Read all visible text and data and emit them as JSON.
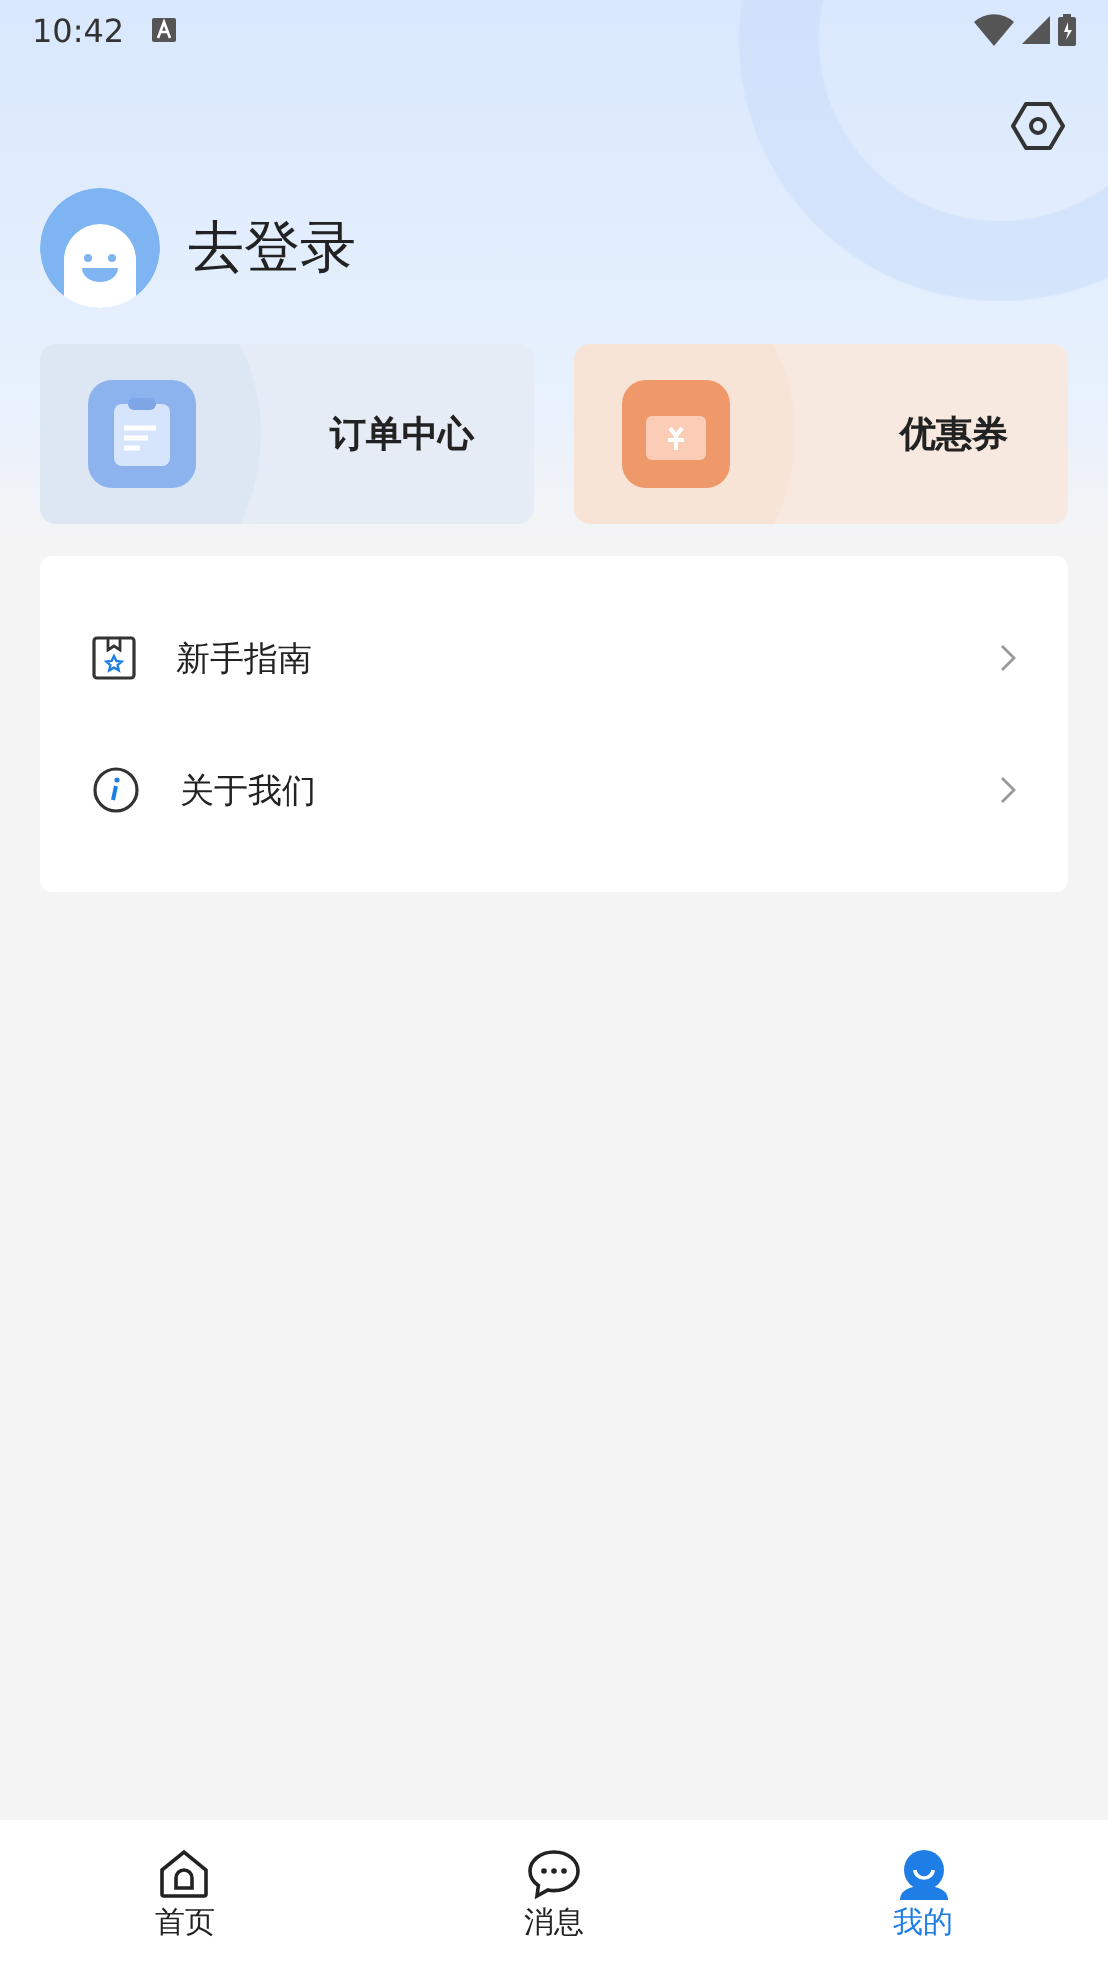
{
  "status_bar": {
    "time": "10:42"
  },
  "profile": {
    "name": "去登录"
  },
  "shortcuts": [
    {
      "kind": "orders",
      "label": "订单中心"
    },
    {
      "kind": "coupons",
      "label": "优惠券"
    }
  ],
  "menu": [
    {
      "kind": "guide",
      "label": "新手指南"
    },
    {
      "kind": "about",
      "label": "关于我们"
    }
  ],
  "tabs": [
    {
      "kind": "home",
      "label": "首页",
      "selected": false
    },
    {
      "kind": "messages",
      "label": "消息",
      "selected": false
    },
    {
      "kind": "profile",
      "label": "我的",
      "selected": true
    }
  ]
}
